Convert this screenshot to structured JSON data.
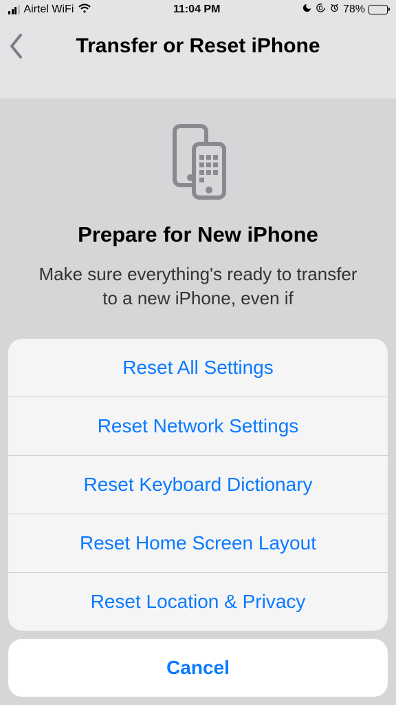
{
  "status": {
    "carrier": "Airtel WiFi",
    "time": "11:04 PM",
    "battery_pct": "78%"
  },
  "nav": {
    "title": "Transfer or Reset iPhone"
  },
  "prepare": {
    "title": "Prepare for New iPhone",
    "body": "Make sure everything's ready to transfer to a new iPhone, even if"
  },
  "sheet": {
    "items": [
      "Reset All Settings",
      "Reset Network Settings",
      "Reset Keyboard Dictionary",
      "Reset Home Screen Layout",
      "Reset Location & Privacy"
    ],
    "cancel": "Cancel"
  }
}
